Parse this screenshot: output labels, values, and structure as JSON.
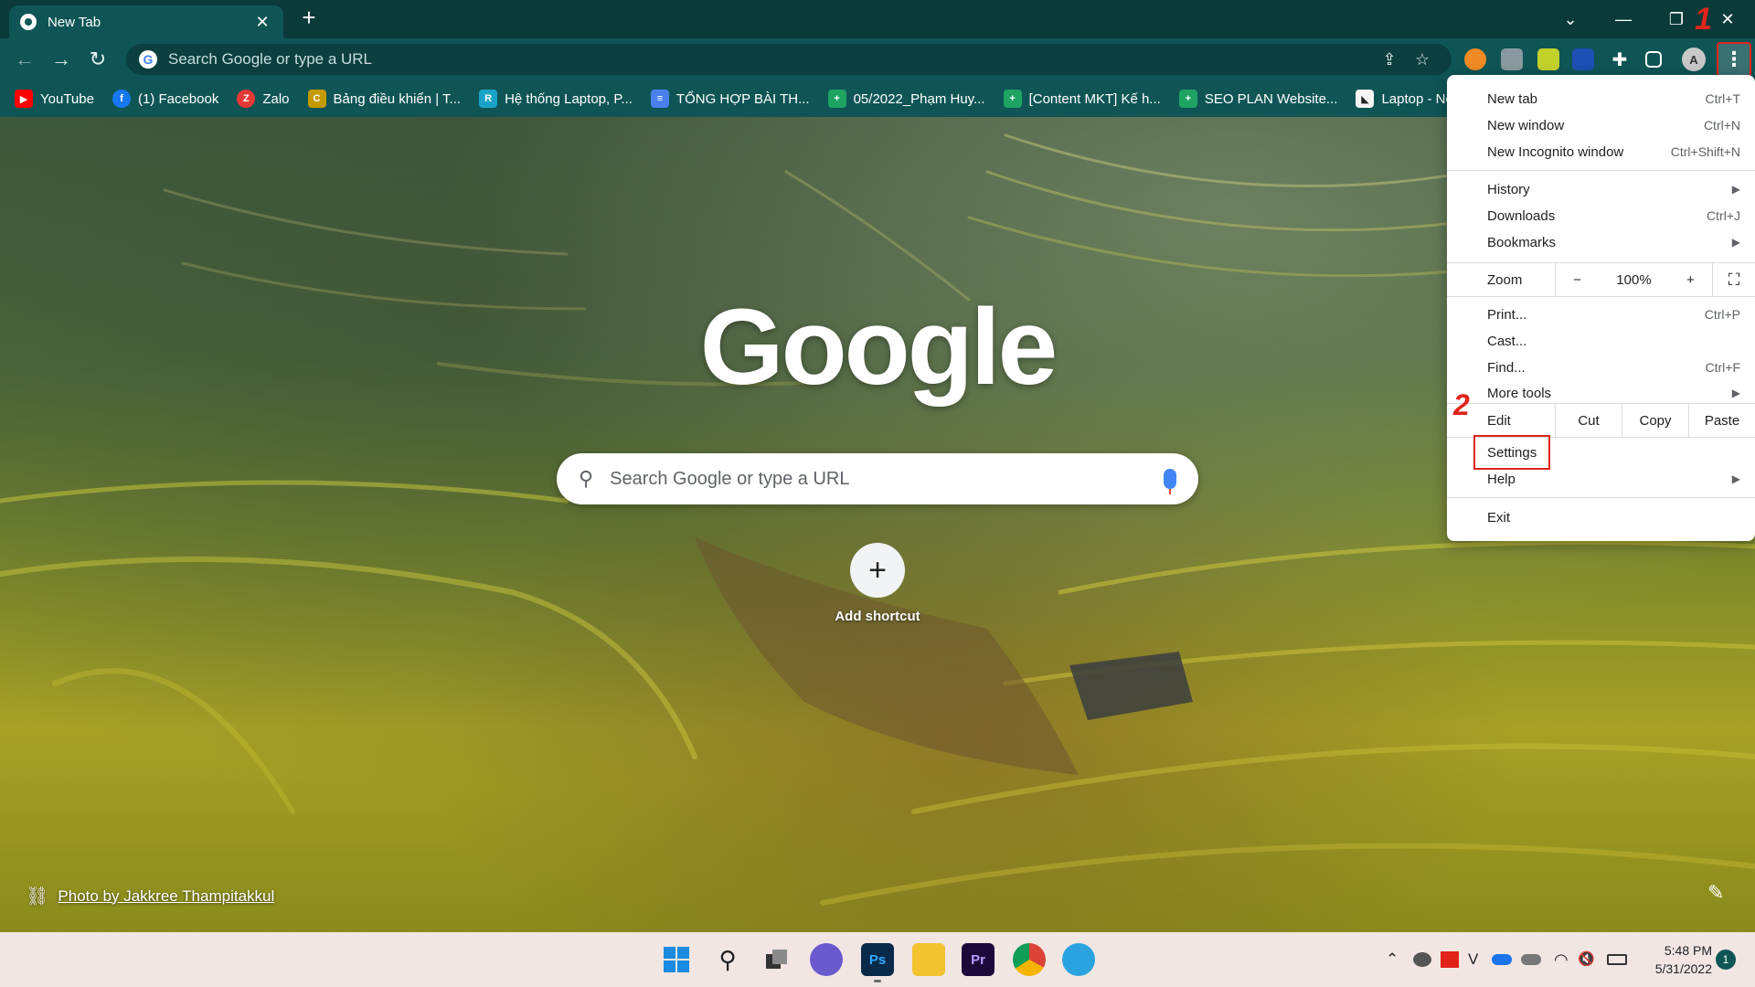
{
  "tab": {
    "title": "New Tab",
    "close": "✕"
  },
  "newtab": "+",
  "window": {
    "dropdown": "⌄",
    "minimize": "—",
    "restore": "❐",
    "close": "✕"
  },
  "annotations": {
    "step1": "1",
    "step2": "2"
  },
  "toolbar": {
    "back": "←",
    "forward": "→",
    "reload": "↻",
    "omnibox_text": "Search Google or type a URL",
    "g": "G",
    "share": "⇪",
    "star": "☆",
    "menu": "⋮",
    "profile": "A"
  },
  "bookmarks": [
    {
      "label": "YouTube",
      "color": "#ff0000",
      "glyph": "▶"
    },
    {
      "label": "(1) Facebook",
      "color": "#1877f2",
      "glyph": "f"
    },
    {
      "label": "Zalo",
      "color": "#e53935",
      "glyph": "Z"
    },
    {
      "label": "Bảng điều khiển | T...",
      "color": "#c49a00",
      "glyph": "C"
    },
    {
      "label": "Hệ thống Laptop, P...",
      "color": "#1aa3c8",
      "glyph": "R"
    },
    {
      "label": "TỔNG HỢP BÀI TH...",
      "color": "#4a7ff0",
      "glyph": "≡"
    },
    {
      "label": "05/2022_Phạm Huy...",
      "color": "#1ea362",
      "glyph": "+"
    },
    {
      "label": "[Content MKT] Kế h...",
      "color": "#1ea362",
      "glyph": "+"
    },
    {
      "label": "SEO PLAN Website...",
      "color": "#1ea362",
      "glyph": "+"
    },
    {
      "label": "Laptop - Nc",
      "color": "#f5f5f5",
      "glyph": "◣"
    }
  ],
  "ntp": {
    "logo": "Google",
    "search_placeholder": "Search Google or type a URL",
    "search_icon": "⚲",
    "shortcut_plus": "+",
    "shortcut_label": "Add shortcut",
    "photo_credit": "Photo by Jakkree Thampitakkul",
    "link_icon": "⛓",
    "edit_icon": "✎"
  },
  "menu": {
    "new_tab": "New tab",
    "new_tab_sc": "Ctrl+T",
    "new_window": "New window",
    "new_window_sc": "Ctrl+N",
    "incognito": "New Incognito window",
    "incognito_sc": "Ctrl+Shift+N",
    "history": "History",
    "downloads": "Downloads",
    "downloads_sc": "Ctrl+J",
    "bookmarks": "Bookmarks",
    "zoom": "Zoom",
    "zoom_minus": "−",
    "zoom_value": "100%",
    "zoom_plus": "+",
    "fullscreen": "⛶",
    "print": "Print...",
    "print_sc": "Ctrl+P",
    "cast": "Cast...",
    "find": "Find...",
    "find_sc": "Ctrl+F",
    "more_tools": "More tools",
    "edit": "Edit",
    "cut": "Cut",
    "copy": "Copy",
    "paste": "Paste",
    "settings": "Settings",
    "help": "Help",
    "exit": "Exit",
    "arrow": "▶"
  },
  "taskbar": {
    "clock_time": "5:48 PM",
    "clock_date": "5/31/2022",
    "notif_count": "1",
    "ps": "Ps",
    "pr": "Pr",
    "tray_up": "⌃",
    "tray_v": "V",
    "tray_mute": "🔇"
  }
}
